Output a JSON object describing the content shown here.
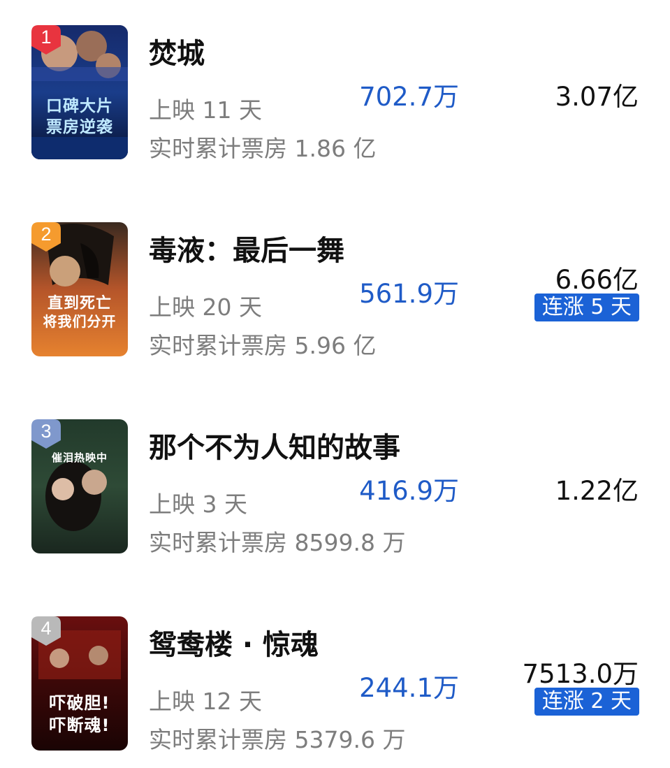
{
  "movies": [
    {
      "rank": "1",
      "title": "焚城",
      "days": "上映 11 天",
      "cumulative": "实时累计票房 1.86 亿",
      "daily": "702.7万",
      "total": "3.07亿",
      "rise": null,
      "poster_text": [
        "口碑大片",
        "票房逆袭"
      ],
      "badge_color": "#e8343f"
    },
    {
      "rank": "2",
      "title": "毒液：最后一舞",
      "days": "上映 20 天",
      "cumulative": "实时累计票房 5.96 亿",
      "daily": "561.9万",
      "total": "6.66亿",
      "rise": "连涨 5 天",
      "poster_text": [
        "直到死亡",
        "将我们分开"
      ],
      "badge_color": "#f59b2e"
    },
    {
      "rank": "3",
      "title": "那个不为人知的故事",
      "days": "上映 3 天",
      "cumulative": "实时累计票房 8599.8 万",
      "daily": "416.9万",
      "total": "1.22亿",
      "rise": null,
      "poster_text": [
        "催泪热映中"
      ],
      "badge_color": "#7f98cc"
    },
    {
      "rank": "4",
      "title": "鸳鸯楼 · 惊魂",
      "days": "上映 12 天",
      "cumulative": "实时累计票房 5379.6 万",
      "daily": "244.1万",
      "total": "7513.0万",
      "rise": "连涨 2 天",
      "poster_text": [
        "吓破胆!",
        "吓断魂!"
      ],
      "badge_color": "#b9b9b9"
    }
  ],
  "colors": {
    "accent_blue": "#1f5bc7",
    "tag_blue": "#1b62d6",
    "muted_gray": "#7d7d7d"
  }
}
